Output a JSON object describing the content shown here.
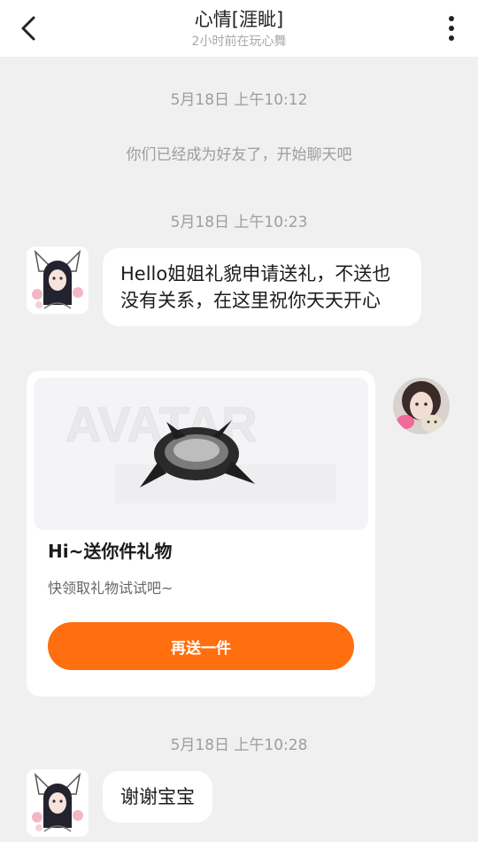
{
  "header": {
    "title": "心情[涯眦]",
    "subtitle": "2小时前在玩心舞",
    "back_icon": "chevron-left-icon",
    "more_icon": "vertical-dots-icon"
  },
  "messages": {
    "ts1": "5月18日 上午10:12",
    "system_msg": "你们已经成为好友了，开始聊天吧",
    "ts2": "5月18日 上午10:23",
    "msg1": "Hello姐姐礼貌申请送礼，不送也没有关系，在这里祝你天天开心",
    "ts3": "5月18日 上午10:28",
    "msg2": "谢谢宝宝"
  },
  "gift_card": {
    "title": "Hi~送你件礼物",
    "desc": "快领取礼物试试吧~",
    "button_label": "再送一件",
    "banner_watermark": "AVATAR",
    "accent": "#ff6f0f"
  }
}
